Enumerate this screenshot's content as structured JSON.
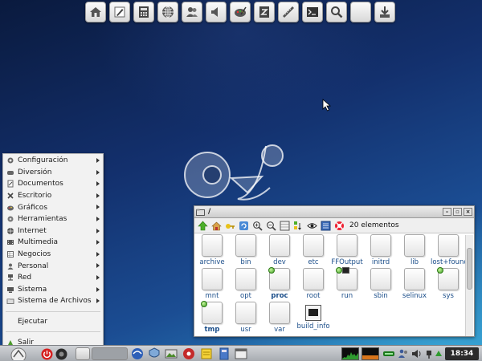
{
  "dock": {
    "icons": [
      "home-icon",
      "pencil-icon",
      "calculator-icon",
      "globe-icon",
      "users-icon",
      "speaker-icon",
      "paint-icon",
      "z-editor-icon",
      "ruler-icon",
      "terminal-icon",
      "search-icon",
      "blank-icon",
      "download-icon"
    ]
  },
  "start_menu": {
    "items": [
      {
        "label": "Configuración",
        "has_sub": true
      },
      {
        "label": "Diversión",
        "has_sub": true
      },
      {
        "label": "Documentos",
        "has_sub": true
      },
      {
        "label": "Escritorio",
        "has_sub": true
      },
      {
        "label": "Gráficos",
        "has_sub": true
      },
      {
        "label": "Herramientas",
        "has_sub": true
      },
      {
        "label": "Internet",
        "has_sub": true
      },
      {
        "label": "Multimedia",
        "has_sub": true
      },
      {
        "label": "Negocios",
        "has_sub": true
      },
      {
        "label": "Personal",
        "has_sub": true
      },
      {
        "label": "Red",
        "has_sub": true
      },
      {
        "label": "Sistema",
        "has_sub": true
      },
      {
        "label": "Sistema de Archivos",
        "has_sub": true
      }
    ],
    "run_label": "Ejecutar",
    "exit_label": "Salir"
  },
  "file_manager": {
    "title": "/",
    "item_count": "20 elementos",
    "files": [
      {
        "name": "archive",
        "badge": false,
        "link": false,
        "bold": false
      },
      {
        "name": "bin",
        "badge": false,
        "link": false,
        "bold": false
      },
      {
        "name": "dev",
        "badge": false,
        "link": false,
        "bold": false
      },
      {
        "name": "etc",
        "badge": false,
        "link": false,
        "bold": false
      },
      {
        "name": "FFOutput",
        "badge": false,
        "link": false,
        "bold": false
      },
      {
        "name": "initrd",
        "badge": false,
        "link": false,
        "bold": false
      },
      {
        "name": "lib",
        "badge": false,
        "link": false,
        "bold": false
      },
      {
        "name": "lost+found",
        "badge": false,
        "link": false,
        "bold": false
      },
      {
        "name": "mnt",
        "badge": false,
        "link": false,
        "bold": false
      },
      {
        "name": "opt",
        "badge": false,
        "link": false,
        "bold": false
      },
      {
        "name": "proc",
        "badge": true,
        "link": false,
        "bold": true
      },
      {
        "name": "root",
        "badge": false,
        "link": false,
        "bold": false
      },
      {
        "name": "run",
        "badge": true,
        "link": true,
        "bold": false
      },
      {
        "name": "sbin",
        "badge": false,
        "link": false,
        "bold": false
      },
      {
        "name": "selinux",
        "badge": false,
        "link": false,
        "bold": false
      },
      {
        "name": "sys",
        "badge": true,
        "link": false,
        "bold": false
      },
      {
        "name": "tmp",
        "badge": true,
        "link": false,
        "bold": true
      },
      {
        "name": "usr",
        "badge": false,
        "link": false,
        "bold": false
      },
      {
        "name": "var",
        "badge": false,
        "link": false,
        "bold": false
      },
      {
        "name": "build_info",
        "badge": false,
        "link": false,
        "bold": false,
        "exec": true
      }
    ]
  },
  "taskbar": {
    "clock": "18:34"
  },
  "colors": {
    "desktop_dark": "#0a1a3e",
    "desktop_light": "#2a8bc4",
    "file_label": "#1b4e8a",
    "badge_green": "#3ea020"
  }
}
